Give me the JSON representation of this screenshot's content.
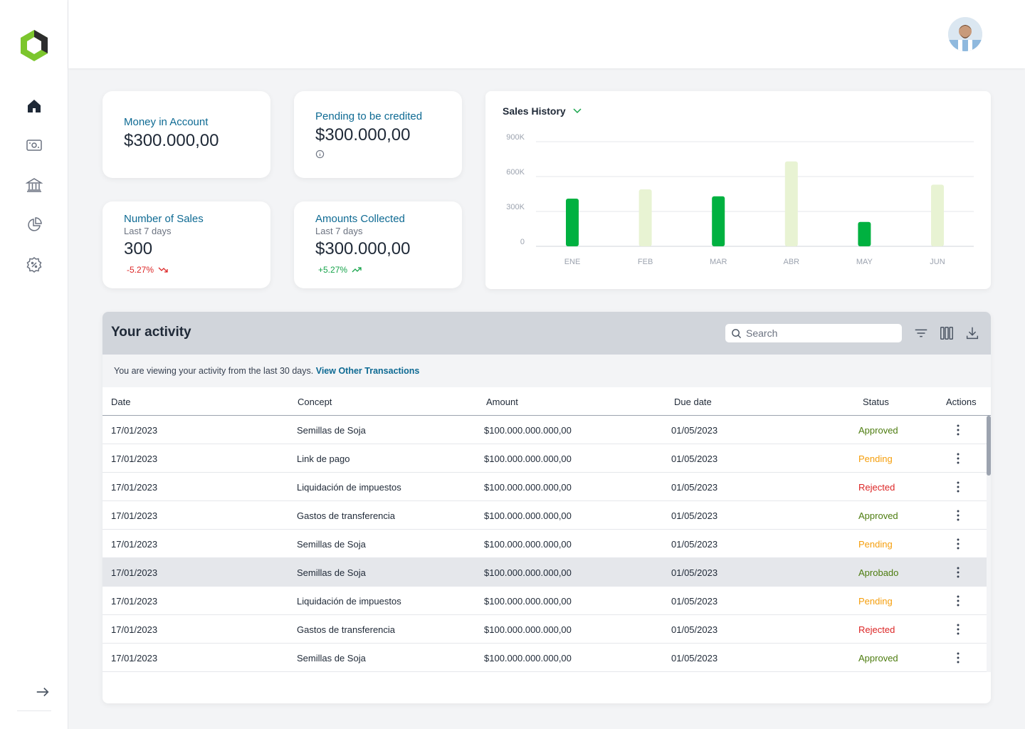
{
  "sidebar": {
    "items": [
      {
        "icon": "home-icon"
      },
      {
        "icon": "money-icon"
      },
      {
        "icon": "bank-icon"
      },
      {
        "icon": "pie-chart-icon"
      },
      {
        "icon": "discount-icon"
      }
    ],
    "collapse_icon": "arrow-right-icon"
  },
  "header": {
    "avatar": "user-avatar"
  },
  "cards": {
    "money_in_account": {
      "label": "Money in Account",
      "value": "$300.000,00"
    },
    "pending_credited": {
      "label": "Pending to be credited",
      "value": "$300.000,00"
    },
    "number_of_sales": {
      "label": "Number of Sales",
      "sub": "Last 7 days",
      "value": "300",
      "delta": "-5.27%"
    },
    "amounts_collected": {
      "label": "Amounts Collected",
      "sub": "Last 7 days",
      "value": "$300.000,00",
      "delta": "+5.27%"
    }
  },
  "colors": {
    "accent": "#0e6a93",
    "bar_dark": "#00b140",
    "bar_light": "#e8f3d3",
    "approved": "#4d7c0f",
    "pending": "#f59e0b",
    "rejected": "#dc2626"
  },
  "chart_data": {
    "type": "bar",
    "title": "Sales History",
    "categories": [
      "ENE",
      "FEB",
      "MAR",
      "ABR",
      "MAY",
      "JUN"
    ],
    "values": [
      410000,
      490000,
      430000,
      730000,
      210000,
      530000
    ],
    "highlight": [
      true,
      false,
      true,
      false,
      true,
      false
    ],
    "yticks": [
      "900K",
      "600K",
      "300K",
      "0"
    ],
    "ytick_values": [
      900000,
      600000,
      300000,
      0
    ],
    "ylim": [
      0,
      900000
    ],
    "grid": true
  },
  "activity": {
    "title": "Your activity",
    "search_placeholder": "Search",
    "info_text": "You are viewing your activity from the last 30 days.",
    "info_link": "View Other Transactions",
    "columns": {
      "date": "Date",
      "concept": "Concept",
      "amount": "Amount",
      "due": "Due date",
      "status": "Status",
      "actions": "Actions"
    },
    "rows": [
      {
        "date": "17/01/2023",
        "concept": "Semillas de Soja",
        "amount": "$100.000.000.000,00",
        "due": "01/05/2023",
        "status": "Approved",
        "kind": "approved"
      },
      {
        "date": "17/01/2023",
        "concept": "Link de pago",
        "amount": "$100.000.000.000,00",
        "due": "01/05/2023",
        "status": "Pending",
        "kind": "pending"
      },
      {
        "date": "17/01/2023",
        "concept": "Liquidación de impuestos",
        "amount": "$100.000.000.000,00",
        "due": "01/05/2023",
        "status": "Rejected",
        "kind": "rejected"
      },
      {
        "date": "17/01/2023",
        "concept": "Gastos de transferencia",
        "amount": "$100.000.000.000,00",
        "due": "01/05/2023",
        "status": "Approved",
        "kind": "approved"
      },
      {
        "date": "17/01/2023",
        "concept": "Semillas de Soja",
        "amount": "$100.000.000.000,00",
        "due": "01/05/2023",
        "status": "Pending",
        "kind": "pending"
      },
      {
        "date": "17/01/2023",
        "concept": "Semillas de Soja",
        "amount": "$100.000.000.000,00",
        "due": "01/05/2023",
        "status": "Aprobado",
        "kind": "aprobado",
        "highlighted": true
      },
      {
        "date": "17/01/2023",
        "concept": "Liquidación de impuestos",
        "amount": "$100.000.000.000,00",
        "due": "01/05/2023",
        "status": "Pending",
        "kind": "pending"
      },
      {
        "date": "17/01/2023",
        "concept": "Gastos de transferencia",
        "amount": "$100.000.000.000,00",
        "due": "01/05/2023",
        "status": "Rejected",
        "kind": "rejected"
      },
      {
        "date": "17/01/2023",
        "concept": "Semillas de Soja",
        "amount": "$100.000.000.000,00",
        "due": "01/05/2023",
        "status": "Approved",
        "kind": "approved"
      }
    ]
  }
}
